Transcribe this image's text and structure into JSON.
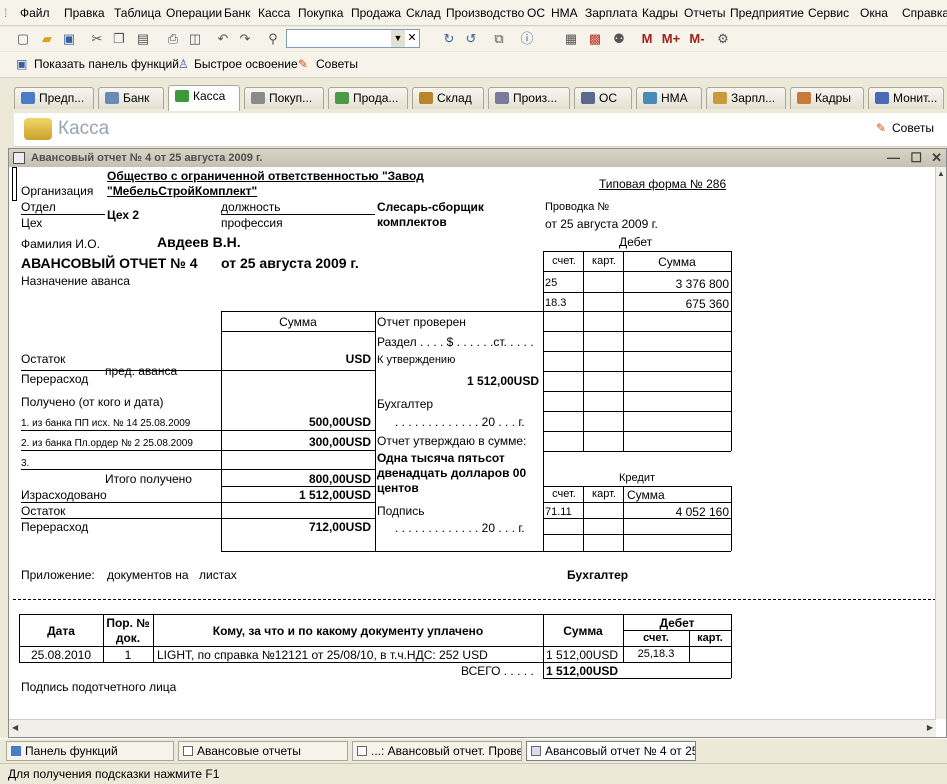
{
  "menu": [
    "Файл",
    "Правка",
    "Таблица",
    "Операции",
    "Банк",
    "Касса",
    "Покупка",
    "Продажа",
    "Склад",
    "Производство",
    "ОС",
    "НМА",
    "Зарплата",
    "Кадры",
    "Отчеты",
    "Предприятие",
    "Сервис",
    "Окна",
    "Справка"
  ],
  "toolbar": {
    "m": "M",
    "mplus": "M+",
    "mminus": "M-",
    "search_value": ""
  },
  "toolbar2": {
    "functions_panel": "Показать панель функций",
    "quick_learn": "Быстрое освоение",
    "tips": "Советы"
  },
  "tabs": [
    "Предп...",
    "Банк",
    "Касса",
    "Покуп...",
    "Прода...",
    "Склад",
    "Произ...",
    "ОС",
    "НМА",
    "Зарпл...",
    "Кадры",
    "Монит..."
  ],
  "section": {
    "title": "Касса",
    "tips": "Советы"
  },
  "window": {
    "title": "Авансовый отчет № 4 от 25 августа 2009 г."
  },
  "form": {
    "org_label": "Организация",
    "org_name_1": "Общество с ограниченной ответственностью \"Завод",
    "org_name_2": "\"МебельСтройКомплект\"",
    "form_type": "Типовая форма № 286",
    "dept_label": "Отдел",
    "dept_sublabel": "Цех",
    "dept_value": "Цех 2",
    "position_label": "должность",
    "position_sublabel": "профессия",
    "position_value_1": "Слесарь-сборщик",
    "position_value_2": "комплектов",
    "posting_label": "Проводка №",
    "posting_date": "от 25 августа 2009 г.",
    "debit_label": "Дебет",
    "fio_label": "Фамилия И.О.",
    "fio_value": "Авдеев В.Н.",
    "report_title": "АВАНСОВЫЙ ОТЧЕТ № 4",
    "report_date": "от 25 августа 2009 г.",
    "purpose_label": "Назначение аванса",
    "col_account": "счет.",
    "col_card": "карт.",
    "col_sum": "Сумма",
    "debit_rows": [
      {
        "account": "25",
        "sum": "3 376 800"
      },
      {
        "account": "18.3",
        "sum": "675 360"
      }
    ],
    "sum_header": "Сумма",
    "remainder_label": "Остаток",
    "prev_advance": "пред. аванса",
    "remainder_currency": "USD",
    "overspend_label": "Перерасход",
    "received_label": "Получено (от кого и дата)",
    "received_rows": [
      {
        "text": "1. из банка ПП исх. № 14 25.08.2009",
        "sum": "500,00USD"
      },
      {
        "text": "2. из банка Пл.ордер № 2 25.08.2009",
        "sum": "300,00USD"
      },
      {
        "text": "3.",
        "sum": ""
      }
    ],
    "total_received_label": "Итого получено",
    "total_received": "800,00USD",
    "spent_label": "Израсходовано",
    "spent": "1 512,00USD",
    "remainder2_label": "Остаток",
    "overspend2_label": "Перерасход",
    "overspend2": "712,00USD",
    "checked_label": "Отчет проверен",
    "section_line": "Раздел . . . . $ . . . . . .ст. . . . .",
    "approve_label": "К утверждению",
    "approve_sum": "1 512,00USD",
    "accountant_label": "Бухгалтер",
    "dots_date": ". . . . . . . . . . . . .  20 . . . г.",
    "approved_label": "Отчет утверждаю в сумме:",
    "sum_words_1": "Одна тысяча пятьсот",
    "sum_words_2": "двенадцать долларов 00",
    "sum_words_3": "центов",
    "signature_label": "Подпись",
    "dots_date2": ". . . . . . . . . . . . .  20 . . . г.",
    "credit_label": "Кредит",
    "credit_rows": [
      {
        "account": "71.11",
        "sum": "4 052 160"
      }
    ],
    "attachment_label": "Приложение:",
    "attachment_text": "документов на",
    "attachment_sheets": "листах",
    "accountant_footer": "Бухгалтер"
  },
  "lower_table": {
    "h_date": "Дата",
    "h_num_1": "Пор. №",
    "h_num_2": "док.",
    "h_desc": "Кому, за что и по какому документу уплачено",
    "h_sum": "Сумма",
    "h_debit": "Дебет",
    "h_account": "счет.",
    "h_card": "карт.",
    "rows": [
      {
        "date": "25.08.2010",
        "num": "1",
        "desc": "LIGHT, по справка №12121 от 25/08/10, в т.ч.НДС: 252 USD",
        "sum": "1 512,00USD",
        "account": "25,18.3",
        "card": ""
      }
    ],
    "total_label": "ВСЕГО . . . . .",
    "total": "1 512,00USD",
    "signature_label": "Подпись подотчетного лица"
  },
  "taskbar": [
    "Панель функций",
    "Авансовые отчеты",
    "...: Авансовый отчет. Прове...",
    "Авансовый отчет № 4 от 25..."
  ],
  "status": "Для получения подсказки нажмите F1",
  "colors": {
    "accent": "#316ac5",
    "toolbar_bg": "#f5f3ea",
    "window_bg": "#ece9d8",
    "title_bar": "#c4c1b2"
  }
}
